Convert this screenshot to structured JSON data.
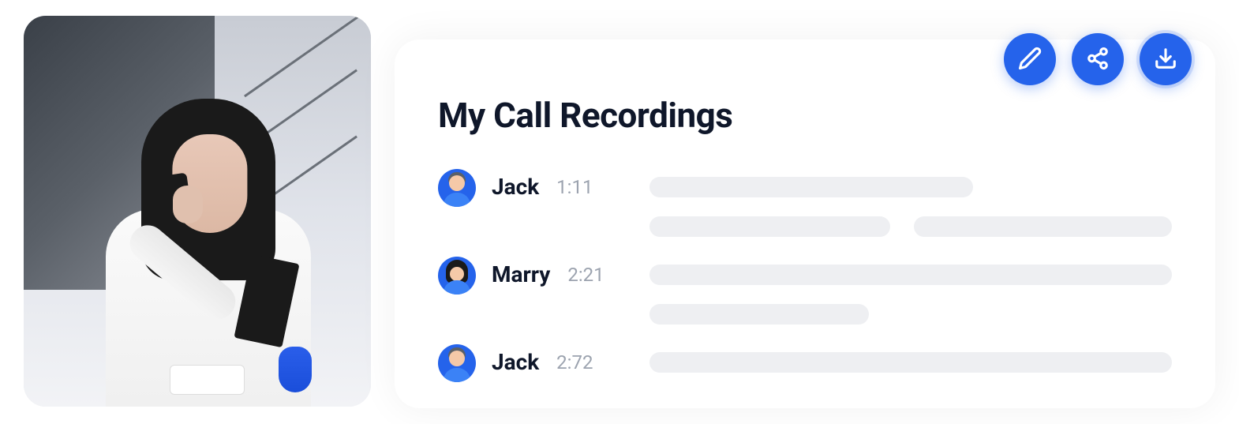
{
  "card": {
    "title": "My Call Recordings"
  },
  "recordings": [
    {
      "name": "Jack",
      "time": "1:11",
      "avatar": "male"
    },
    {
      "name": "Marry",
      "time": "2:21",
      "avatar": "female"
    },
    {
      "name": "Jack",
      "time": "2:72",
      "avatar": "male"
    }
  ],
  "actions": {
    "edit": "edit",
    "share": "share",
    "download": "download"
  }
}
